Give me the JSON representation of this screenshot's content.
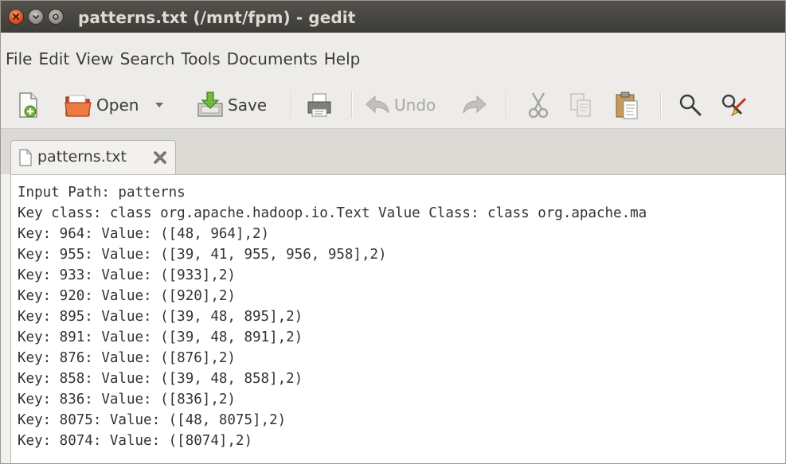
{
  "window": {
    "title": "patterns.txt (/mnt/fpm) - gedit"
  },
  "menu": [
    "File",
    "Edit",
    "View",
    "Search",
    "Tools",
    "Documents",
    "Help"
  ],
  "toolbar": {
    "open_label": "Open",
    "save_label": "Save",
    "undo_label": "Undo"
  },
  "tab": {
    "label": "patterns.txt"
  },
  "editor": {
    "lines": [
      "Input Path: patterns",
      "Key class: class org.apache.hadoop.io.Text Value Class: class org.apache.ma",
      "Key: 964: Value: ([48, 964],2)",
      "Key: 955: Value: ([39, 41, 955, 956, 958],2)",
      "Key: 933: Value: ([933],2)",
      "Key: 920: Value: ([920],2)",
      "Key: 895: Value: ([39, 48, 895],2)",
      "Key: 891: Value: ([39, 48, 891],2)",
      "Key: 876: Value: ([876],2)",
      "Key: 858: Value: ([39, 48, 858],2)",
      "Key: 836: Value: ([836],2)",
      "Key: 8075: Value: ([48, 8075],2)",
      "Key: 8074: Value: ([8074],2)"
    ]
  },
  "icons": {
    "titlebar": [
      "close-icon",
      "minimize-icon",
      "maximize-icon"
    ],
    "toolbar": [
      "new-document-icon",
      "open-folder-icon",
      "dropdown-arrow-icon",
      "save-icon",
      "print-icon",
      "undo-icon",
      "redo-icon",
      "cut-icon",
      "copy-icon",
      "paste-icon",
      "find-icon",
      "find-replace-icon"
    ],
    "tab": [
      "document-icon",
      "close-tab-icon"
    ]
  },
  "colors": {
    "titlebar": "#3d3c38",
    "close_button": "#d8501c",
    "editor_text": "#2e3436"
  }
}
